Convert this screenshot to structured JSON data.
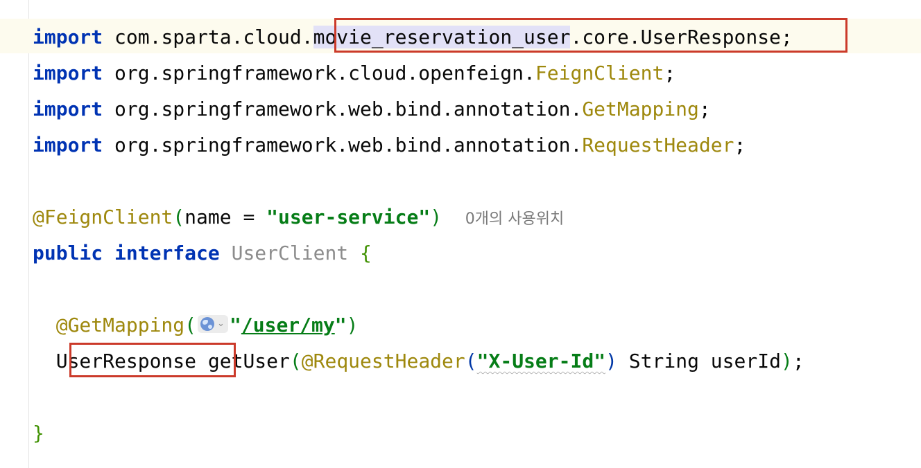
{
  "editor": {
    "imports": [
      {
        "keyword": "import",
        "pkg_before": "com.sparta.cloud.",
        "selected": "movie_reservation_user",
        "pkg_after": ".core.UserResponse",
        "end": ";"
      },
      {
        "keyword": "import",
        "pkg": "org.springframework.cloud.openfeign.",
        "cls": "FeignClient",
        "end": ";"
      },
      {
        "keyword": "import",
        "pkg": "org.springframework.web.bind.annotation.",
        "cls": "GetMapping",
        "end": ";"
      },
      {
        "keyword": "import",
        "pkg": "org.springframework.web.bind.annotation.",
        "cls": "RequestHeader",
        "end": ";"
      }
    ],
    "annotation_line": {
      "annotation": "@FeignClient",
      "open": "(",
      "param": "name = ",
      "value": "\"user-service\"",
      "close": ")",
      "usages_hint": "0개의 사용위치"
    },
    "interface_line": {
      "kw_public": "public",
      "kw_interface": "interface",
      "name": "UserClient",
      "brace": "{"
    },
    "getmapping_line": {
      "annotation": "@GetMapping",
      "open": "(",
      "quote_open": "\"",
      "path": "/user/my",
      "quote_close": "\"",
      "close": ")"
    },
    "method_line": {
      "return_type": "UserResponse",
      "method": "getUser",
      "open": "(",
      "param_annotation": "@RequestHeader",
      "ann_open": "(",
      "header_value": "\"X-User-Id\"",
      "ann_close": ")",
      "param_type": "String",
      "param_name": "userId",
      "close": ")",
      "end": ";"
    },
    "closing_brace": "}"
  },
  "colors": {
    "keyword": "#0033b3",
    "annotation": "#9e880d",
    "string": "#067d17",
    "highlight_box": "#cb3a2a",
    "selection": "#e2e1f7",
    "caret_row": "#fdfbee"
  },
  "icons": {
    "url_chip": "globe-icon"
  }
}
